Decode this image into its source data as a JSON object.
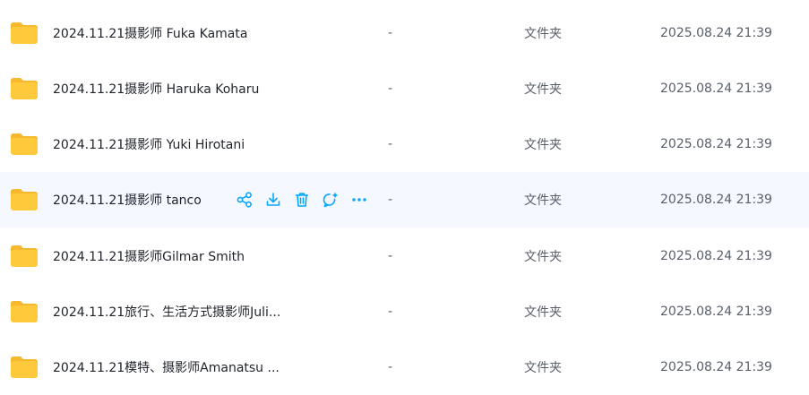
{
  "files": [
    {
      "name": "2024.11.21摄影师 Fuka Kamata",
      "size": "-",
      "type": "文件夹",
      "modified": "2025.08.24 21:39"
    },
    {
      "name": "2024.11.21摄影师 Haruka Koharu",
      "size": "-",
      "type": "文件夹",
      "modified": "2025.08.24 21:39"
    },
    {
      "name": "2024.11.21摄影师 Yuki Hirotani",
      "size": "-",
      "type": "文件夹",
      "modified": "2025.08.24 21:39"
    },
    {
      "name": "2024.11.21摄影师 tanco",
      "size": "-",
      "type": "文件夹",
      "modified": "2025.08.24 21:39"
    },
    {
      "name": "2024.11.21摄影师Gilmar Smith",
      "size": "-",
      "type": "文件夹",
      "modified": "2025.08.24 21:39"
    },
    {
      "name": "2024.11.21旅行、生活方式摄影师Juli...",
      "size": "-",
      "type": "文件夹",
      "modified": "2025.08.24 21:39"
    },
    {
      "name": "2024.11.21模特、摄影师Amanatsu ...",
      "size": "-",
      "type": "文件夹",
      "modified": "2025.08.24 21:39"
    }
  ],
  "row_actions": [
    "share-icon",
    "download-icon",
    "delete-icon",
    "ai-assistant-icon",
    "more-icon"
  ],
  "colors": {
    "folder": "#FFC93C",
    "folder_tab": "#F5B82E",
    "accent": "#06a7ff",
    "hover_bg": "#f5f8fe"
  }
}
